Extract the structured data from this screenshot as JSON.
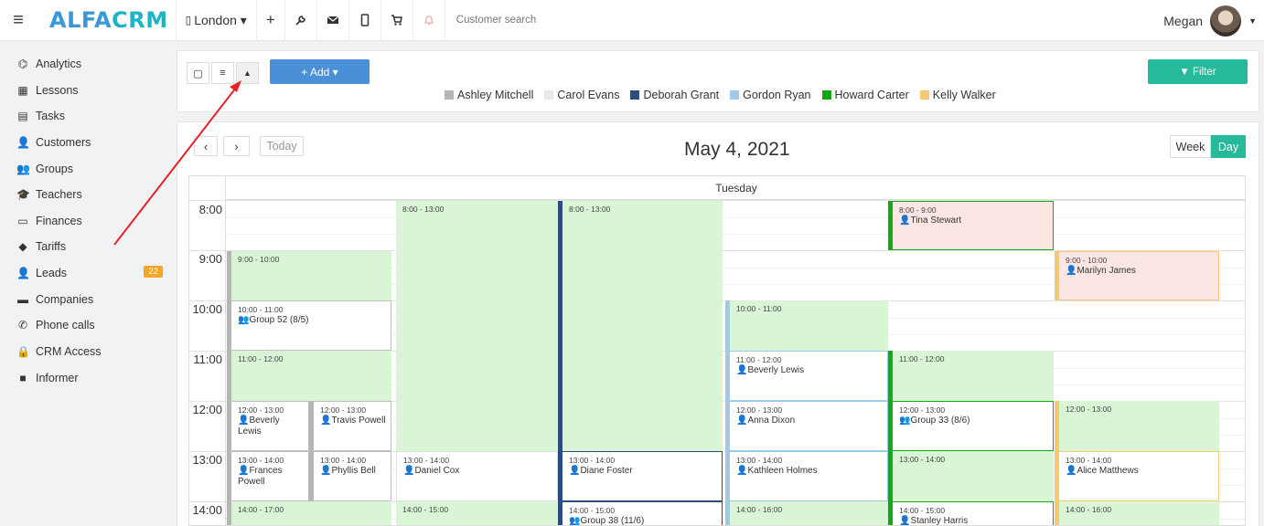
{
  "app": {
    "logo_part1": "ALFA",
    "logo_part2": "CRM"
  },
  "topbar": {
    "branch": "London ▾",
    "search_placeholder": "Customer search",
    "user_name": "Megan"
  },
  "sidebar": {
    "items": [
      {
        "label": "Analytics",
        "icon": "analytics-icon",
        "glyph": "⌬"
      },
      {
        "label": "Lessons",
        "icon": "calendar-icon",
        "glyph": "▦"
      },
      {
        "label": "Tasks",
        "icon": "clipboard-icon",
        "glyph": "▤"
      },
      {
        "label": "Customers",
        "icon": "user-icon",
        "glyph": "👤"
      },
      {
        "label": "Groups",
        "icon": "users-icon",
        "glyph": "👥"
      },
      {
        "label": "Teachers",
        "icon": "graduation-cap-icon",
        "glyph": "🎓"
      },
      {
        "label": "Finances",
        "icon": "money-icon",
        "glyph": "▭"
      },
      {
        "label": "Tariffs",
        "icon": "tag-icon",
        "glyph": "◆"
      },
      {
        "label": "Leads",
        "icon": "user-plus-icon",
        "glyph": "👤"
      },
      {
        "label": "Companies",
        "icon": "briefcase-icon",
        "glyph": "▬"
      },
      {
        "label": "Phone calls",
        "icon": "phone-icon",
        "glyph": "✆"
      },
      {
        "label": "CRM Access",
        "icon": "lock-icon",
        "glyph": "🔒"
      },
      {
        "label": "Informer",
        "icon": "informer-icon",
        "glyph": "■"
      }
    ],
    "leads_badge": "22"
  },
  "toolbar": {
    "add_label": "+ Add ▾",
    "filter_label": "▼ Filter"
  },
  "legend": [
    {
      "name": "Ashley Mitchell",
      "color": "#b5b5b5"
    },
    {
      "name": "Carol Evans",
      "color": "#e8e8e8"
    },
    {
      "name": "Deborah Grant",
      "color": "#2c4b7f"
    },
    {
      "name": "Gordon Ryan",
      "color": "#9fcbe8"
    },
    {
      "name": "Howard Carter",
      "color": "#16a716"
    },
    {
      "name": "Kelly Walker",
      "color": "#f7c873"
    }
  ],
  "calendar": {
    "today_label": "Today",
    "title": "May 4, 2021",
    "week_label": "Week",
    "day_label": "Day",
    "day_header": "Tuesday",
    "hours": [
      "8:00",
      "9:00",
      "10:00",
      "11:00",
      "12:00",
      "13:00",
      "14:00"
    ]
  },
  "events": [
    {
      "time": "9:00 - 10:00",
      "name": ""
    },
    {
      "time": "10:00 - 11:00",
      "name": "Group 52 (8/5)"
    },
    {
      "time": "11:00 - 12:00",
      "name": ""
    },
    {
      "time": "12:00 - 13:00",
      "name": "Beverly Lewis"
    },
    {
      "time": "12:00 - 13:00",
      "name": "Travis Powell"
    },
    {
      "time": "13:00 - 14:00",
      "name": "Frances Powell"
    },
    {
      "time": "13:00 - 14:00",
      "name": "Phyllis Bell"
    },
    {
      "time": "14:00 - 17:00",
      "name": ""
    },
    {
      "time": "8:00 - 13:00",
      "name": ""
    },
    {
      "time": "13:00 - 14:00",
      "name": "Daniel Cox"
    },
    {
      "time": "14:00 - 15:00",
      "name": ""
    },
    {
      "time": "8:00 - 13:00",
      "name": ""
    },
    {
      "time": "13:00 - 14:00",
      "name": "Diane Foster"
    },
    {
      "time": "14:00 - 15:00",
      "name": "Group 38 (11/6)"
    },
    {
      "time": "10:00 - 11:00",
      "name": ""
    },
    {
      "time": "11:00 - 12:00",
      "name": "Beverly Lewis"
    },
    {
      "time": "12:00 - 13:00",
      "name": "Anna Dixon"
    },
    {
      "time": "13:00 - 14:00",
      "name": "Kathleen Holmes"
    },
    {
      "time": "14:00 - 16:00",
      "name": ""
    },
    {
      "time": "8:00 - 9:00",
      "name": "Tina Stewart"
    },
    {
      "time": "11:00 - 12:00",
      "name": ""
    },
    {
      "time": "12:00 - 13:00",
      "name": "Group 33 (8/6)"
    },
    {
      "time": "13:00 - 14:00",
      "name": ""
    },
    {
      "time": "14:00 - 15:00",
      "name": "Stanley Harris"
    },
    {
      "time": "9:00 - 10:00",
      "name": "Marilyn James"
    },
    {
      "time": "12:00 - 13:00",
      "name": ""
    },
    {
      "time": "13:00 - 14:00",
      "name": "Alice Matthews"
    },
    {
      "time": "14:00 - 16:00",
      "name": ""
    }
  ]
}
